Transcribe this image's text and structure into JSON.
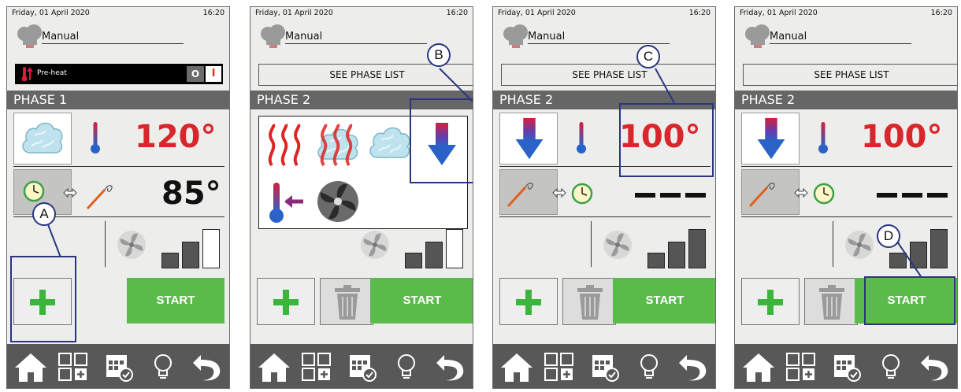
{
  "common": {
    "date": "Friday, 01 April 2020",
    "time": "16:20",
    "mode": "Manual",
    "see_phase_list": "SEE PHASE LIST",
    "start": "START"
  },
  "panel1": {
    "preheat_label": "Pre-heat",
    "switch_off": "O",
    "switch_on": "I",
    "phase": "PHASE 1",
    "temperature": "120°",
    "probe_temperature": "85°",
    "fan_level": 2,
    "callout": "A"
  },
  "panel2": {
    "phase": "PHASE 2",
    "callout": "B",
    "options": [
      "convection-icon",
      "combi-icon",
      "steam-icon",
      "cooling-icon",
      "preheat-arrow-icon",
      "fan-icon"
    ]
  },
  "panel3": {
    "phase": "PHASE 2",
    "temperature": "100°",
    "callout": "C",
    "fan_level": 3
  },
  "panel4": {
    "phase": "PHASE 2",
    "temperature": "100°",
    "callout": "D",
    "fan_level": 3
  },
  "colors": {
    "accent_green": "#5aba4a",
    "value_red": "#d9262c",
    "callout_blue": "#2a3580",
    "nav_gray": "#585858"
  }
}
